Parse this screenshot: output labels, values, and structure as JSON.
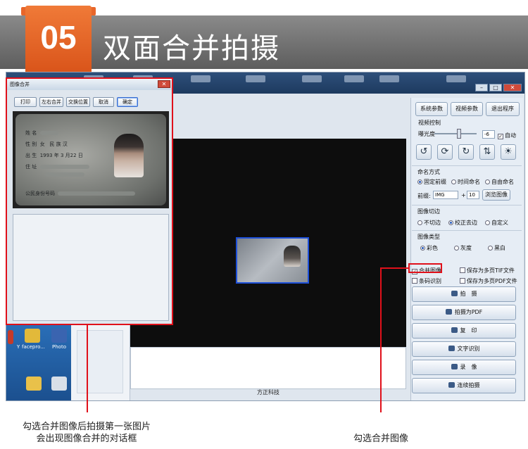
{
  "banner": {
    "step": "05",
    "title": "双面合并拍摄"
  },
  "dialog": {
    "title": "图像合并",
    "buttons": [
      "打印",
      "左右合并",
      "交换位置",
      "取消",
      "确定"
    ],
    "card": {
      "name_label": "姓 名",
      "gender_label": "性 别",
      "gender_value": "女",
      "ethnicity_label": "民 族",
      "ethnicity_value": "汉",
      "birth_label": "出 生",
      "birth_value": "1993 年 3 月22 日",
      "address_label": "住 址",
      "id_label": "公民身份号码"
    }
  },
  "panel": {
    "top_buttons": [
      "系统参数",
      "视频参数",
      "退出程序"
    ],
    "video_control": "视频控制",
    "exposure": "曝光度",
    "exposure_value": "-6",
    "auto": "自动",
    "naming": "命名方式",
    "naming_options": [
      "固定前缀",
      "时间命名",
      "自由命名"
    ],
    "prefix_label": "前缀:",
    "prefix_value": "IMG",
    "prefix_plus": "+",
    "prefix_num": "10",
    "browse": "浏览图像",
    "crop": "图像切边",
    "crop_options": [
      "不切边",
      "校正去边",
      "自定义"
    ],
    "image_type": "图像类型",
    "type_options": [
      "彩色",
      "灰度",
      "黑白"
    ],
    "checks": [
      "合并图像",
      "保存为多页TIF文件",
      "条码识别",
      "保存为多页PDF文件"
    ],
    "actions": [
      "拍　摄",
      "拍摄为PDF",
      "复　印",
      "文字识别",
      "录　像",
      "连续拍摄"
    ]
  },
  "status": {
    "brand": "方正科技"
  },
  "desktop": {
    "icons": [
      "facepro...",
      "Photo",
      "Y"
    ]
  },
  "captions": {
    "left_line1": "勾选合并图像后拍摄第一张图片",
    "left_line2": "会出现图像合并的对话框",
    "right": "勾选合并图像"
  },
  "colors": {
    "highlight": "#e0101a",
    "banner_accent": "#e8662a"
  }
}
